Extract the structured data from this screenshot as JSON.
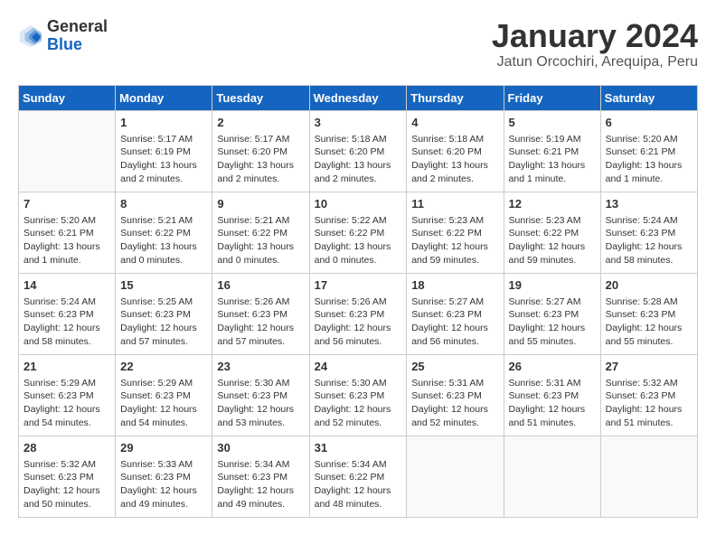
{
  "header": {
    "logo": {
      "line1": "General",
      "line2": "Blue"
    },
    "title": "January 2024",
    "subtitle": "Jatun Orcochiri, Arequipa, Peru"
  },
  "days_of_week": [
    "Sunday",
    "Monday",
    "Tuesday",
    "Wednesday",
    "Thursday",
    "Friday",
    "Saturday"
  ],
  "weeks": [
    [
      {
        "day": "",
        "sunrise": "",
        "sunset": "",
        "daylight": ""
      },
      {
        "day": "1",
        "sunrise": "Sunrise: 5:17 AM",
        "sunset": "Sunset: 6:19 PM",
        "daylight": "Daylight: 13 hours and 2 minutes."
      },
      {
        "day": "2",
        "sunrise": "Sunrise: 5:17 AM",
        "sunset": "Sunset: 6:20 PM",
        "daylight": "Daylight: 13 hours and 2 minutes."
      },
      {
        "day": "3",
        "sunrise": "Sunrise: 5:18 AM",
        "sunset": "Sunset: 6:20 PM",
        "daylight": "Daylight: 13 hours and 2 minutes."
      },
      {
        "day": "4",
        "sunrise": "Sunrise: 5:18 AM",
        "sunset": "Sunset: 6:20 PM",
        "daylight": "Daylight: 13 hours and 2 minutes."
      },
      {
        "day": "5",
        "sunrise": "Sunrise: 5:19 AM",
        "sunset": "Sunset: 6:21 PM",
        "daylight": "Daylight: 13 hours and 1 minute."
      },
      {
        "day": "6",
        "sunrise": "Sunrise: 5:20 AM",
        "sunset": "Sunset: 6:21 PM",
        "daylight": "Daylight: 13 hours and 1 minute."
      }
    ],
    [
      {
        "day": "7",
        "sunrise": "Sunrise: 5:20 AM",
        "sunset": "Sunset: 6:21 PM",
        "daylight": "Daylight: 13 hours and 1 minute."
      },
      {
        "day": "8",
        "sunrise": "Sunrise: 5:21 AM",
        "sunset": "Sunset: 6:22 PM",
        "daylight": "Daylight: 13 hours and 0 minutes."
      },
      {
        "day": "9",
        "sunrise": "Sunrise: 5:21 AM",
        "sunset": "Sunset: 6:22 PM",
        "daylight": "Daylight: 13 hours and 0 minutes."
      },
      {
        "day": "10",
        "sunrise": "Sunrise: 5:22 AM",
        "sunset": "Sunset: 6:22 PM",
        "daylight": "Daylight: 13 hours and 0 minutes."
      },
      {
        "day": "11",
        "sunrise": "Sunrise: 5:23 AM",
        "sunset": "Sunset: 6:22 PM",
        "daylight": "Daylight: 12 hours and 59 minutes."
      },
      {
        "day": "12",
        "sunrise": "Sunrise: 5:23 AM",
        "sunset": "Sunset: 6:22 PM",
        "daylight": "Daylight: 12 hours and 59 minutes."
      },
      {
        "day": "13",
        "sunrise": "Sunrise: 5:24 AM",
        "sunset": "Sunset: 6:23 PM",
        "daylight": "Daylight: 12 hours and 58 minutes."
      }
    ],
    [
      {
        "day": "14",
        "sunrise": "Sunrise: 5:24 AM",
        "sunset": "Sunset: 6:23 PM",
        "daylight": "Daylight: 12 hours and 58 minutes."
      },
      {
        "day": "15",
        "sunrise": "Sunrise: 5:25 AM",
        "sunset": "Sunset: 6:23 PM",
        "daylight": "Daylight: 12 hours and 57 minutes."
      },
      {
        "day": "16",
        "sunrise": "Sunrise: 5:26 AM",
        "sunset": "Sunset: 6:23 PM",
        "daylight": "Daylight: 12 hours and 57 minutes."
      },
      {
        "day": "17",
        "sunrise": "Sunrise: 5:26 AM",
        "sunset": "Sunset: 6:23 PM",
        "daylight": "Daylight: 12 hours and 56 minutes."
      },
      {
        "day": "18",
        "sunrise": "Sunrise: 5:27 AM",
        "sunset": "Sunset: 6:23 PM",
        "daylight": "Daylight: 12 hours and 56 minutes."
      },
      {
        "day": "19",
        "sunrise": "Sunrise: 5:27 AM",
        "sunset": "Sunset: 6:23 PM",
        "daylight": "Daylight: 12 hours and 55 minutes."
      },
      {
        "day": "20",
        "sunrise": "Sunrise: 5:28 AM",
        "sunset": "Sunset: 6:23 PM",
        "daylight": "Daylight: 12 hours and 55 minutes."
      }
    ],
    [
      {
        "day": "21",
        "sunrise": "Sunrise: 5:29 AM",
        "sunset": "Sunset: 6:23 PM",
        "daylight": "Daylight: 12 hours and 54 minutes."
      },
      {
        "day": "22",
        "sunrise": "Sunrise: 5:29 AM",
        "sunset": "Sunset: 6:23 PM",
        "daylight": "Daylight: 12 hours and 54 minutes."
      },
      {
        "day": "23",
        "sunrise": "Sunrise: 5:30 AM",
        "sunset": "Sunset: 6:23 PM",
        "daylight": "Daylight: 12 hours and 53 minutes."
      },
      {
        "day": "24",
        "sunrise": "Sunrise: 5:30 AM",
        "sunset": "Sunset: 6:23 PM",
        "daylight": "Daylight: 12 hours and 52 minutes."
      },
      {
        "day": "25",
        "sunrise": "Sunrise: 5:31 AM",
        "sunset": "Sunset: 6:23 PM",
        "daylight": "Daylight: 12 hours and 52 minutes."
      },
      {
        "day": "26",
        "sunrise": "Sunrise: 5:31 AM",
        "sunset": "Sunset: 6:23 PM",
        "daylight": "Daylight: 12 hours and 51 minutes."
      },
      {
        "day": "27",
        "sunrise": "Sunrise: 5:32 AM",
        "sunset": "Sunset: 6:23 PM",
        "daylight": "Daylight: 12 hours and 51 minutes."
      }
    ],
    [
      {
        "day": "28",
        "sunrise": "Sunrise: 5:32 AM",
        "sunset": "Sunset: 6:23 PM",
        "daylight": "Daylight: 12 hours and 50 minutes."
      },
      {
        "day": "29",
        "sunrise": "Sunrise: 5:33 AM",
        "sunset": "Sunset: 6:23 PM",
        "daylight": "Daylight: 12 hours and 49 minutes."
      },
      {
        "day": "30",
        "sunrise": "Sunrise: 5:34 AM",
        "sunset": "Sunset: 6:23 PM",
        "daylight": "Daylight: 12 hours and 49 minutes."
      },
      {
        "day": "31",
        "sunrise": "Sunrise: 5:34 AM",
        "sunset": "Sunset: 6:22 PM",
        "daylight": "Daylight: 12 hours and 48 minutes."
      },
      {
        "day": "",
        "sunrise": "",
        "sunset": "",
        "daylight": ""
      },
      {
        "day": "",
        "sunrise": "",
        "sunset": "",
        "daylight": ""
      },
      {
        "day": "",
        "sunrise": "",
        "sunset": "",
        "daylight": ""
      }
    ]
  ]
}
